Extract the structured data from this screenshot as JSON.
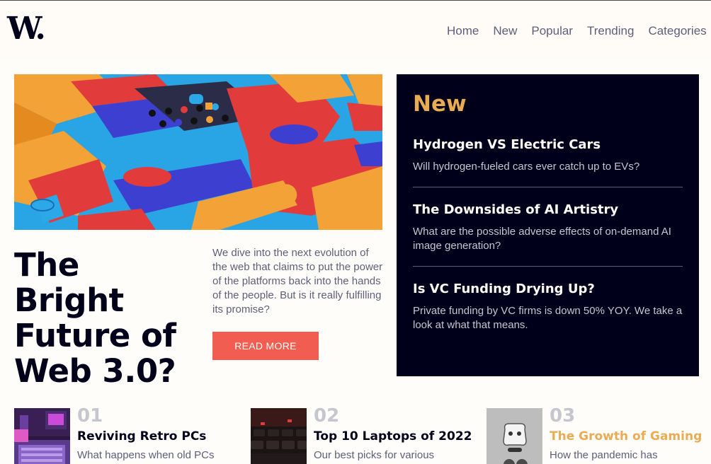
{
  "brand": {
    "logo": "W."
  },
  "nav": {
    "items": [
      {
        "label": "Home"
      },
      {
        "label": "New"
      },
      {
        "label": "Popular"
      },
      {
        "label": "Trending"
      },
      {
        "label": "Categories"
      }
    ]
  },
  "hero": {
    "title": "The Bright Future of Web 3.0?",
    "description": "We dive into the next evolution of the web that claims to put the power of the platforms back into the hands of the people. But is it really fulfilling its promise?",
    "button": "READ MORE"
  },
  "new_panel": {
    "title": "New",
    "items": [
      {
        "title": "Hydrogen VS Electric Cars",
        "desc": "Will hydrogen-fueled cars ever catch up to EVs?"
      },
      {
        "title": "The Downsides of AI Artistry",
        "desc": "What are the possible adverse effects of on-demand AI image generation?"
      },
      {
        "title": "Is VC Funding Drying Up?",
        "desc": "Private funding by VC firms is down 50% YOY. We take a look at what that means."
      }
    ]
  },
  "cards": [
    {
      "num": "01",
      "title": "Reviving Retro PCs",
      "desc": "What happens when old PCs"
    },
    {
      "num": "02",
      "title": "Top 10 Laptops of 2022",
      "desc": "Our best picks for various"
    },
    {
      "num": "03",
      "title": "The Growth of Gaming",
      "desc": "How the pandemic has"
    }
  ],
  "colors": {
    "dark": "#00001a",
    "accent_orange": "#e9ab53",
    "accent_red": "#f15d51",
    "gray_text": "#5d5f79",
    "background": "#fffdfa"
  }
}
